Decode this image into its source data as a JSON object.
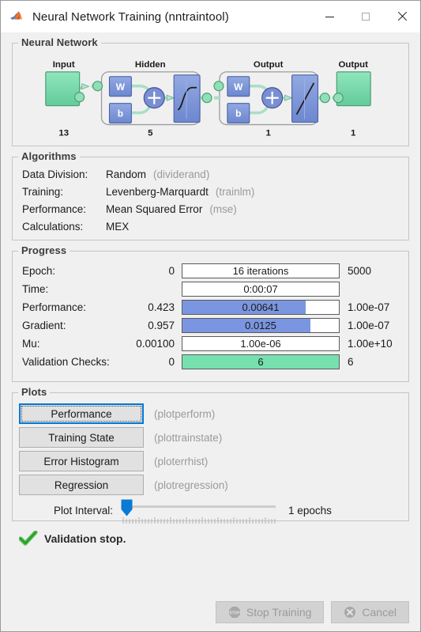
{
  "window": {
    "title": "Neural Network Training (nntraintool)",
    "icon": "matlab-membrane-icon",
    "controls": {
      "minimize": "minimize-icon",
      "maximize": "maximize-icon",
      "close": "close-icon"
    }
  },
  "neural_network": {
    "legend": "Neural Network",
    "input": {
      "label": "Input",
      "size": "13"
    },
    "hidden": {
      "label": "Hidden",
      "size": "5",
      "weight": "W",
      "bias": "b",
      "sum": "+",
      "transfer": "sigmoid"
    },
    "output_layer": {
      "label": "Output",
      "size": "1",
      "weight": "W",
      "bias": "b",
      "sum": "+",
      "transfer": "linear"
    },
    "output": {
      "label": "Output",
      "size": "1"
    }
  },
  "algorithms": {
    "legend": "Algorithms",
    "rows": [
      {
        "label": "Data Division:",
        "value": "Random",
        "fn": "(dividerand)"
      },
      {
        "label": "Training:",
        "value": "Levenberg-Marquardt",
        "fn": "(trainlm)"
      },
      {
        "label": "Performance:",
        "value": "Mean Squared Error",
        "fn": "(mse)"
      },
      {
        "label": "Calculations:",
        "value": "MEX",
        "fn": ""
      }
    ]
  },
  "progress": {
    "legend": "Progress",
    "rows": [
      {
        "label": "Epoch:",
        "start": "0",
        "bar_text": "16 iterations",
        "fill_pct": 0,
        "fill_color": "none",
        "max": "5000"
      },
      {
        "label": "Time:",
        "start": "",
        "bar_text": "0:00:07",
        "fill_pct": 0,
        "fill_color": "none",
        "max": ""
      },
      {
        "label": "Performance:",
        "start": "0.423",
        "bar_text": "0.00641",
        "fill_pct": 79,
        "fill_color": "blue",
        "max": "1.00e-07"
      },
      {
        "label": "Gradient:",
        "start": "0.957",
        "bar_text": "0.0125",
        "fill_pct": 82,
        "fill_color": "blue",
        "max": "1.00e-07"
      },
      {
        "label": "Mu:",
        "start": "0.00100",
        "bar_text": "1.00e-06",
        "fill_pct": 0,
        "fill_color": "none",
        "max": "1.00e+10"
      },
      {
        "label": "Validation Checks:",
        "start": "0",
        "bar_text": "6",
        "fill_pct": 100,
        "fill_color": "green",
        "max": "6"
      }
    ]
  },
  "plots": {
    "legend": "Plots",
    "buttons": [
      {
        "label": "Performance",
        "fn": "(plotperform)",
        "focused": true
      },
      {
        "label": "Training State",
        "fn": "(plottrainstate)",
        "focused": false
      },
      {
        "label": "Error Histogram",
        "fn": "(ploterrhist)",
        "focused": false
      },
      {
        "label": "Regression",
        "fn": "(plotregression)",
        "focused": false
      }
    ],
    "slider": {
      "label": "Plot Interval:",
      "value_text": "1 epochs",
      "position_pct": 0
    }
  },
  "status": {
    "icon": "green-check-icon",
    "text": "Validation stop."
  },
  "footer": {
    "stop_training": {
      "label": "Stop Training",
      "icon": "stop-sign-icon",
      "disabled": true
    },
    "cancel": {
      "label": "Cancel",
      "icon": "circle-x-icon",
      "disabled": true
    }
  },
  "colors": {
    "bar_blue": "#7b96e0",
    "bar_green": "#76e0ae",
    "node_green": "#7fdcae",
    "block_blue": "#7f97d8",
    "focus_blue": "#0078d7",
    "slider_blue": "#0a7ad4",
    "check_green": "#35b134"
  }
}
